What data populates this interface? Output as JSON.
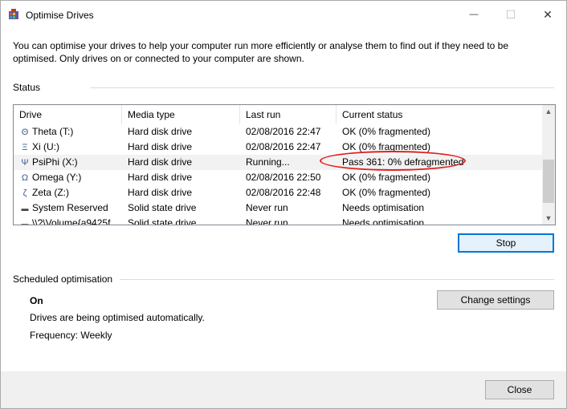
{
  "window": {
    "title": "Optimise Drives",
    "minimize_symbol": "—",
    "maximize_symbol": "☐",
    "close_symbol": "✕"
  },
  "description": "You can optimise your drives to help your computer run more efficiently or analyse them to find out if they need to be optimised. Only drives on or connected to your computer are shown.",
  "status": {
    "label": "Status",
    "columns": [
      "Drive",
      "Media type",
      "Last run",
      "Current status"
    ],
    "rows": [
      {
        "icon": "Θ",
        "icon_name": "theta-drive-icon",
        "drive": "Theta (T:)",
        "media": "Hard disk drive",
        "last_run": "02/08/2016 22:47",
        "status": "OK (0% fragmented)"
      },
      {
        "icon": "Ξ",
        "icon_name": "xi-drive-icon",
        "drive": "Xi (U:)",
        "media": "Hard disk drive",
        "last_run": "02/08/2016 22:47",
        "status": "OK (0% fragmented)"
      },
      {
        "icon": "Ψ",
        "icon_name": "psiphi-drive-icon",
        "drive": "PsiPhi (X:)",
        "media": "Hard disk drive",
        "last_run": "Running...",
        "status": "Pass 361: 0% defragmented"
      },
      {
        "icon": "Ω",
        "icon_name": "omega-drive-icon",
        "drive": "Omega (Y:)",
        "media": "Hard disk drive",
        "last_run": "02/08/2016 22:50",
        "status": "OK (0% fragmented)"
      },
      {
        "icon": "ζ",
        "icon_name": "zeta-drive-icon",
        "drive": "Zeta (Z:)",
        "media": "Hard disk drive",
        "last_run": "02/08/2016 22:48",
        "status": "OK (0% fragmented)"
      },
      {
        "icon": "▬",
        "icon_name": "system-drive-icon",
        "drive": "System Reserved",
        "media": "Solid state drive",
        "last_run": "Never run",
        "status": "Needs optimisation"
      },
      {
        "icon": "▬",
        "icon_name": "volume-drive-icon",
        "drive": "\\\\?\\Volume{a9425f",
        "media": "Solid state drive",
        "last_run": "Never run",
        "status": "Needs optimisation"
      }
    ],
    "highlight_color": "#e02020"
  },
  "buttons": {
    "stop": "Stop",
    "change_settings": "Change settings",
    "close": "Close"
  },
  "scheduled": {
    "label": "Scheduled optimisation",
    "state": "On",
    "line1": "Drives are being optimised automatically.",
    "line2": "Frequency: Weekly"
  },
  "colors": {
    "accent": "#0078d7",
    "scrollbar_arrow": "▲▼"
  }
}
